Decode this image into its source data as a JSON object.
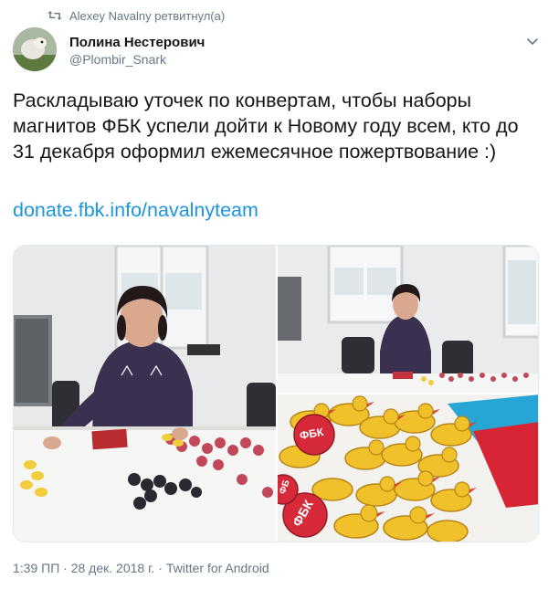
{
  "retweet": {
    "text": "Alexey Navalny ретвитнул(а)",
    "icon": "retweet-icon"
  },
  "author": {
    "name": "Полина Нестерович",
    "handle": "@Plombir_Snark",
    "avatar_icon": "avatar"
  },
  "tweet": {
    "text": "Раскладываю уточек по конвертам, чтобы наборы магнитов ФБК успели дойти к Новому году всем, кто до 31 декабря оформил ежемесячное пожертвование :)",
    "link": "donate.fbk.info/navalnyteam"
  },
  "media": {
    "badge_text_1": "ФБК",
    "badge_text_2": "ФБК",
    "badge_text_3": "ФБ"
  },
  "meta": {
    "time": "1:39 ПП",
    "date": "28 дек. 2018 г.",
    "source": "Twitter for Android",
    "separator": "·"
  },
  "colors": {
    "link": "#1b95e0",
    "secondary": "#657786",
    "duck": "#f2c12e",
    "badge": "#d62a3a",
    "envelope_red": "#d8202f",
    "envelope_blue": "#28a8d8"
  }
}
